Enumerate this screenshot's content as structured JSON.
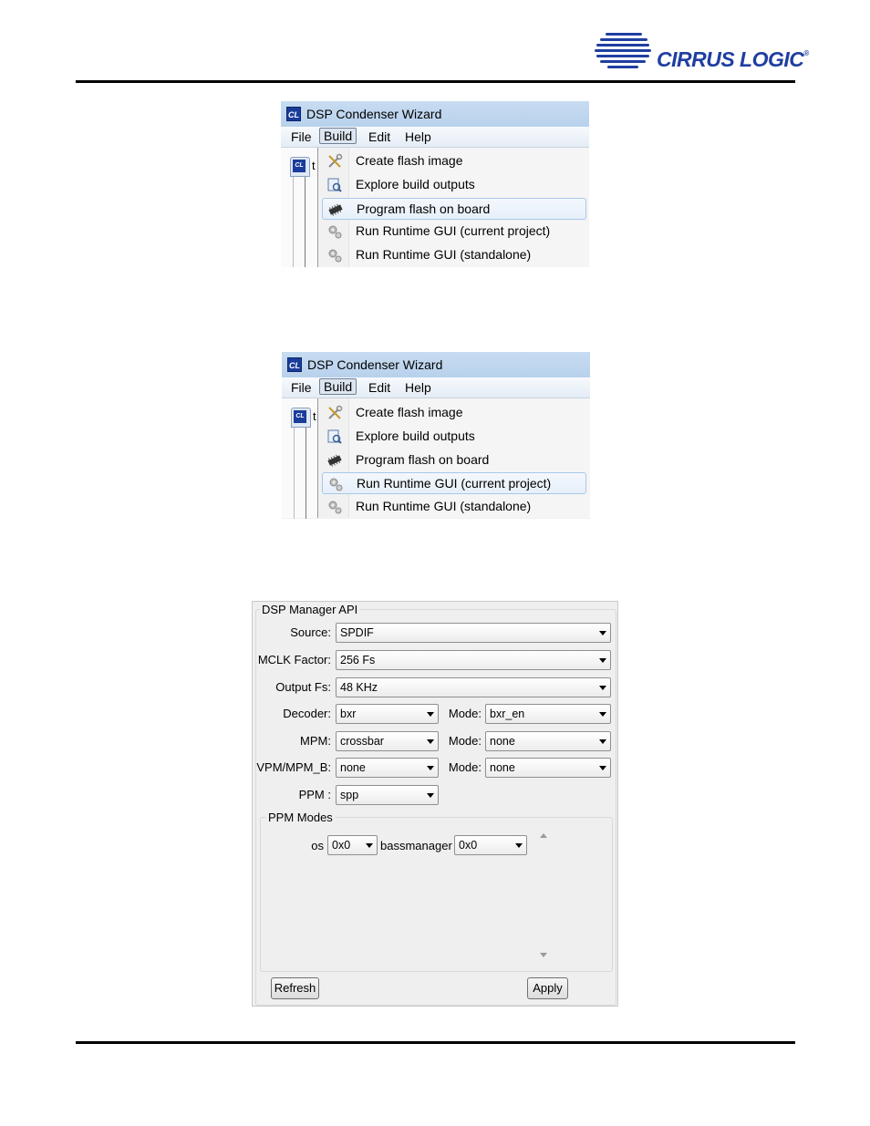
{
  "header": {
    "logo_text": "CIRRUS LOGIC",
    "logo_mark": "®"
  },
  "wizard1": {
    "title": "DSP Condenser Wizard",
    "app_icon": "CL",
    "menu": [
      "File",
      "Build",
      "Edit",
      "Help"
    ],
    "active_menu": "Build",
    "tab_char": "t",
    "items": [
      {
        "label": "Create flash image",
        "icon": "tools-icon"
      },
      {
        "label": "Explore build outputs",
        "icon": "explore-icon"
      },
      {
        "label": "Program flash on board",
        "icon": "chip-icon"
      },
      {
        "label": "Run Runtime GUI (current project)",
        "icon": "gears-icon"
      },
      {
        "label": "Run Runtime GUI (standalone)",
        "icon": "gears-icon"
      }
    ],
    "highlighted_item": "Program flash on board"
  },
  "wizard2": {
    "title": "DSP Condenser Wizard",
    "app_icon": "CL",
    "menu": [
      "File",
      "Build",
      "Edit",
      "Help"
    ],
    "active_menu": "Build",
    "tab_char": "t",
    "items": [
      {
        "label": "Create flash image",
        "icon": "tools-icon"
      },
      {
        "label": "Explore build outputs",
        "icon": "explore-icon"
      },
      {
        "label": "Program flash on board",
        "icon": "chip-icon"
      },
      {
        "label": "Run Runtime GUI (current project)",
        "icon": "gears-icon"
      },
      {
        "label": "Run Runtime GUI (standalone)",
        "icon": "gears-icon"
      }
    ],
    "highlighted_item": "Run Runtime GUI (current project)"
  },
  "dsp_panel": {
    "group_title": "DSP Manager API",
    "source": {
      "label": "Source:",
      "value": "SPDIF"
    },
    "mclk": {
      "label": "MCLK Factor:",
      "value": "256 Fs"
    },
    "output_fs": {
      "label": "Output Fs:",
      "value": "48 KHz"
    },
    "decoder": {
      "label": "Decoder:",
      "value": "bxr",
      "mode_label": "Mode:",
      "mode_value": "bxr_en"
    },
    "mpm": {
      "label": "MPM:",
      "value": "crossbar",
      "mode_label": "Mode:",
      "mode_value": "none"
    },
    "vpm": {
      "label": "VPM/MPM_B:",
      "value": "none",
      "mode_label": "Mode:",
      "mode_value": "none"
    },
    "ppm": {
      "label": "PPM :",
      "value": "spp"
    },
    "ppm_modes": {
      "title": "PPM Modes",
      "os_label": "os",
      "os_value": "0x0",
      "bass_label": "bassmanager",
      "bass_value": "0x0"
    },
    "refresh_label": "Refresh",
    "apply_label": "Apply"
  }
}
